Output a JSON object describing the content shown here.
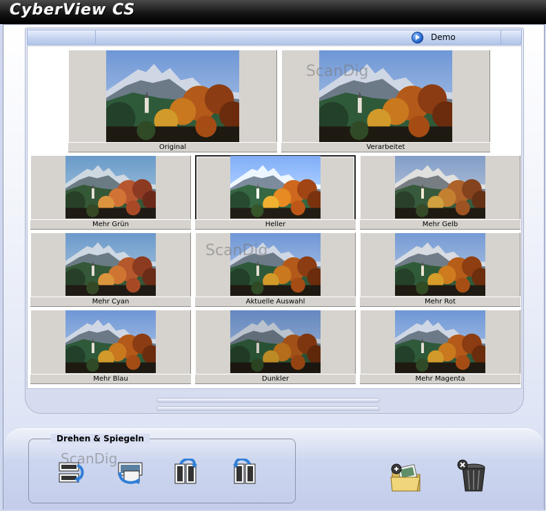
{
  "window": {
    "title": "CyberView CS"
  },
  "header": {
    "demo_label": "Demo"
  },
  "tiles": {
    "original": "Original",
    "processed": "Verarbeitet",
    "more_green": "Mehr Grün",
    "brighter": "Heller",
    "more_yellow": "Mehr Gelb",
    "more_cyan": "Mehr Cyan",
    "current": "Aktuelle Auswahl",
    "more_red": "Mehr Rot",
    "more_blue": "Mehr Blau",
    "darker": "Dunkler",
    "more_magenta": "Mehr Magenta"
  },
  "selected_tile": "brighter",
  "watermark": "ScanDig",
  "toolbar": {
    "group_title": "Drehen & Spiegeln"
  },
  "icons": [
    "flip-vertical-icon",
    "rotate-icon",
    "mirror-left-icon",
    "mirror-right-icon",
    "add-folder-icon",
    "trash-icon"
  ],
  "colors": {
    "title_bar": "#111111",
    "tile_bg": "#d6d3ce",
    "header_blue": "#b4c6ea"
  }
}
